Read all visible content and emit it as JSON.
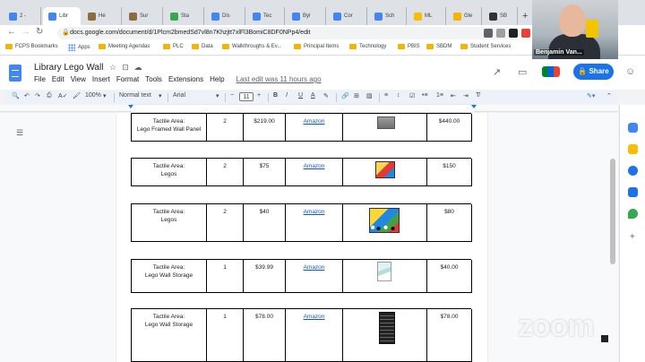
{
  "browser": {
    "tabs": [
      {
        "label": "2 -",
        "color": "#4285f4"
      },
      {
        "label": "Libr",
        "color": "#4285f4",
        "active": true
      },
      {
        "label": "He",
        "color": "#8e6b3c"
      },
      {
        "label": "Sur",
        "color": "#8e6b3c"
      },
      {
        "label": "Sta",
        "color": "#34a853"
      },
      {
        "label": "Dis",
        "color": "#4285f4"
      },
      {
        "label": "Tec",
        "color": "#4285f4"
      },
      {
        "label": "Byl",
        "color": "#4285f4"
      },
      {
        "label": "Cor",
        "color": "#4285f4"
      },
      {
        "label": "Sch",
        "color": "#4285f4"
      },
      {
        "label": "ML",
        "color": "#fbbc04"
      },
      {
        "label": "Gle",
        "color": "#f4b400"
      },
      {
        "label": "SB",
        "color": "#333333"
      }
    ],
    "url": "docs.google.com/document/d/1Plcm2bmedSd7vl8n7Khzjtt7xlFl3BomiC8DF0NPp4/edit",
    "bookmarks": [
      "FCPS Bookmarks",
      "Apps",
      "Meeting Agendas",
      "PLC",
      "Data",
      "Walkthroughs & Ev...",
      "Principal Items",
      "Technology",
      "PBIS",
      "SBDM",
      "Student Services"
    ]
  },
  "docs": {
    "title": "Library  Lego Wall",
    "menu": [
      "File",
      "Edit",
      "View",
      "Insert",
      "Format",
      "Tools",
      "Extensions",
      "Help"
    ],
    "last_edit": "Last edit was 11 hours ago",
    "share_label": "Share",
    "toolbar": {
      "zoom": "100%",
      "style": "Normal text",
      "font": "Arial",
      "size": "11"
    }
  },
  "table": {
    "rows": [
      {
        "area": "Tactile Area:\nLego Framed Wall Panel",
        "qty": "2",
        "price": "$219.00",
        "vendor": "Amazon",
        "image": "wall-panel-image",
        "total": "$440.00"
      },
      {
        "area": "Tactile Area:\nLegos",
        "qty": "2",
        "price": "$75",
        "vendor": "Amazon",
        "image": "lego-box-image",
        "total": "$150"
      },
      {
        "area": "Tactile Area:\nLegos",
        "qty": "2",
        "price": "$40",
        "vendor": "Amazon",
        "image": "lego-set-image",
        "total": "$80"
      },
      {
        "area": "Tactile Area:\nLego Wall Storage",
        "qty": "1",
        "price": "$39.99",
        "vendor": "Amazon",
        "image": "storage-image",
        "total": "$40.00"
      },
      {
        "area": "Tactile Area:\nLego Wall Storage",
        "qty": "1",
        "price": "$78.00",
        "vendor": "Amazon",
        "image": "storage-tower-image",
        "total": "$78.00"
      }
    ]
  },
  "webcam": {
    "name": "Benjamin Van..."
  },
  "zoom_watermark": "zoom"
}
